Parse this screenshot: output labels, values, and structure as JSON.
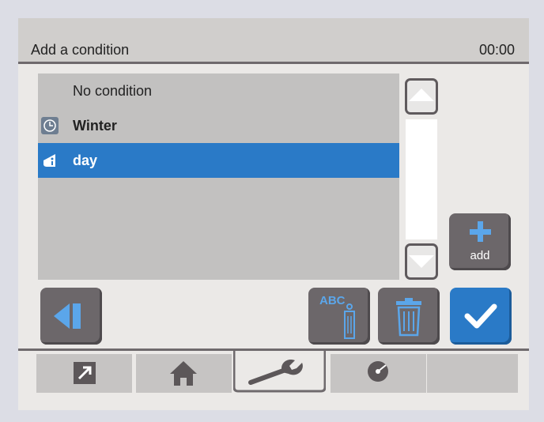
{
  "header": {
    "title": "Add a condition",
    "time": "00:00"
  },
  "list": {
    "items": [
      {
        "label": "No condition",
        "icon": "none",
        "bold": false,
        "selected": false
      },
      {
        "label": "Winter",
        "icon": "clock-icon",
        "bold": true,
        "selected": false
      },
      {
        "label": "day",
        "icon": "daynight-icon",
        "bold": true,
        "selected": true
      }
    ]
  },
  "buttons": {
    "add_label": "add",
    "rename_badge": "ABC"
  },
  "tabs": [
    {
      "name": "shortcut-icon",
      "active": false
    },
    {
      "name": "home-icon",
      "active": false
    },
    {
      "name": "wrench-icon",
      "active": true
    },
    {
      "name": "disc-icon",
      "active": false
    },
    {
      "name": "empty",
      "active": false
    }
  ],
  "colors": {
    "accent": "#2a7ac7",
    "button": "#6c676a",
    "icon": "#5ba6ea"
  }
}
